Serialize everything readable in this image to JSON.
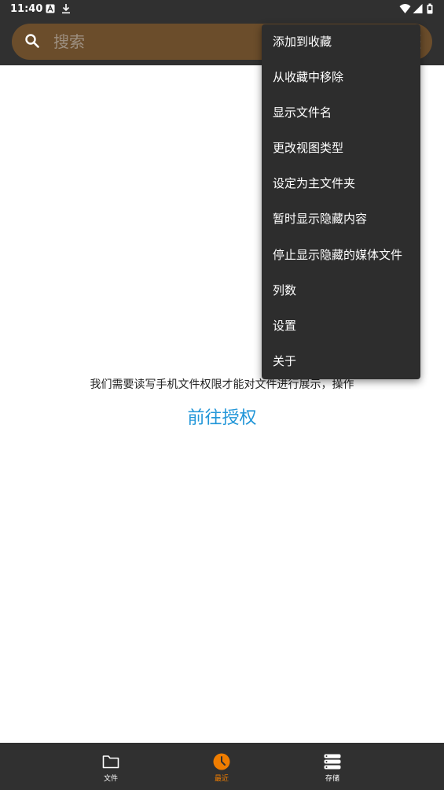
{
  "status_bar": {
    "time": "11:40",
    "icons": [
      "a-badge-icon",
      "download-icon",
      "wifi-icon",
      "signal-icon",
      "battery-icon"
    ]
  },
  "search": {
    "placeholder": "搜索"
  },
  "menu": {
    "items": [
      {
        "label": "添加到收藏"
      },
      {
        "label": "从收藏中移除"
      },
      {
        "label": "显示文件名"
      },
      {
        "label": "更改视图类型"
      },
      {
        "label": "设定为主文件夹"
      },
      {
        "label": "暂时显示隐藏内容"
      },
      {
        "label": "停止显示隐藏的媒体文件"
      },
      {
        "label": "列数"
      },
      {
        "label": "设置"
      },
      {
        "label": "关于"
      }
    ]
  },
  "main": {
    "permission_message": "我们需要读写手机文件权限才能对文件进行展示，操作",
    "grant_link": "前往授权"
  },
  "bottom_nav": {
    "tabs": [
      {
        "label": "文件",
        "icon": "folder-icon",
        "active": false
      },
      {
        "label": "最近",
        "icon": "clock-icon",
        "active": true
      },
      {
        "label": "存储",
        "icon": "storage-icon",
        "active": false
      }
    ]
  },
  "colors": {
    "bar_bg": "#303030",
    "search_bg": "#6b4d2b",
    "menu_bg": "#2d2d2d",
    "accent": "#ef7d00",
    "link": "#2196d8"
  }
}
